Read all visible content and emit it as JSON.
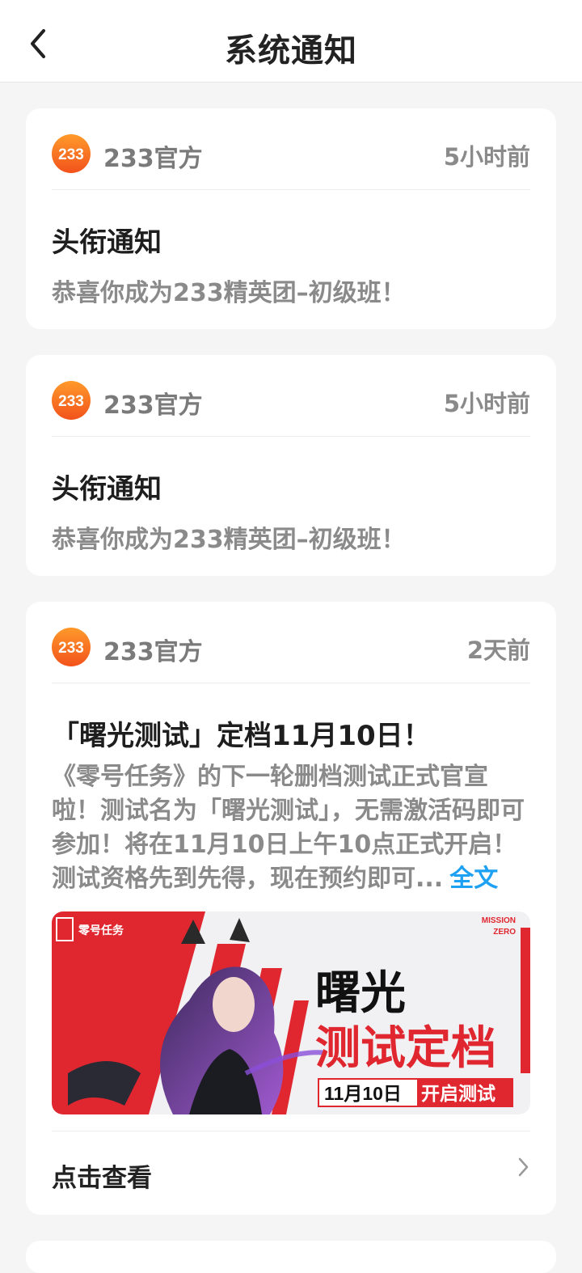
{
  "header": {
    "title": "系统通知"
  },
  "notifications": [
    {
      "sender": "233官方",
      "avatar_text": "233",
      "time": "5小时前",
      "title": "头衔通知",
      "body": "恭喜你成为233精英团–初级班！"
    },
    {
      "sender": "233官方",
      "avatar_text": "233",
      "time": "5小时前",
      "title": "头衔通知",
      "body": "恭喜你成为233精英团–初级班！"
    },
    {
      "sender": "233官方",
      "avatar_text": "233",
      "time": "2天前",
      "title": "「曙光测试」定档11月10日！",
      "body": "《零号任务》的下一轮删档测试正式官宣啦！测试名为「曙光测试」，无需激活码即可参加！将在11月10日上午10点正式开启！测试资格先到先得，现在预约即可...",
      "more_label": "全文",
      "banner": {
        "brand": "零号任务",
        "corner": "MISSION ZERO",
        "headline_1": "曙光",
        "headline_2": "测试定档",
        "date_pill_date": "11月10日",
        "date_pill_action": "开启测试"
      },
      "view_label": "点击查看"
    }
  ],
  "colors": {
    "avatar_gradient_top": "#ff9a2a",
    "avatar_gradient_bottom": "#f2521c",
    "link": "#1ea1f2",
    "banner_red": "#e0262f"
  }
}
